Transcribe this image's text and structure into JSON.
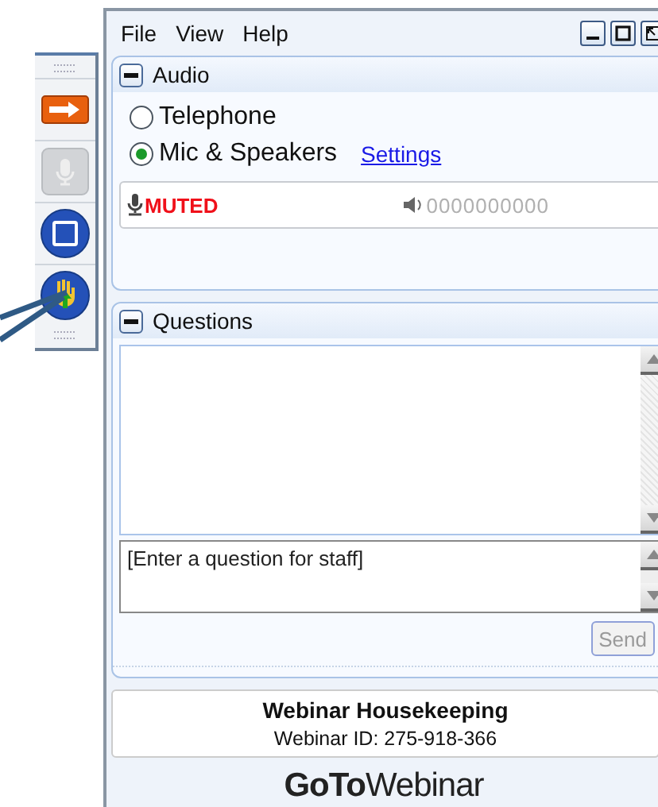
{
  "toolbar": [
    {
      "kind": "arrow",
      "disabled": false
    },
    {
      "kind": "mic",
      "disabled": true
    },
    {
      "kind": "screen",
      "disabled": false
    },
    {
      "kind": "hand",
      "disabled": false
    }
  ],
  "menu": [
    {
      "label": "File"
    },
    {
      "label": "View"
    },
    {
      "label": "Help"
    }
  ],
  "audio": {
    "title": "Audio",
    "expanded": true,
    "options": [
      {
        "label": "Telephone",
        "selected": false
      },
      {
        "label": "Mic & Speakers",
        "selected": true
      }
    ],
    "settings_link": "Settings",
    "mic_status": "MUTED",
    "speaker_meter": "0000000000"
  },
  "questions": {
    "title": "Questions",
    "expanded": true,
    "placeholder": "[Enter a question for staff]",
    "send_button": "Send"
  },
  "info": {
    "title": "Webinar Housekeeping",
    "webinar_id": "Webinar ID: 275-918-366"
  },
  "brand": {
    "bold": "GoTo",
    "light": "Webinar"
  }
}
